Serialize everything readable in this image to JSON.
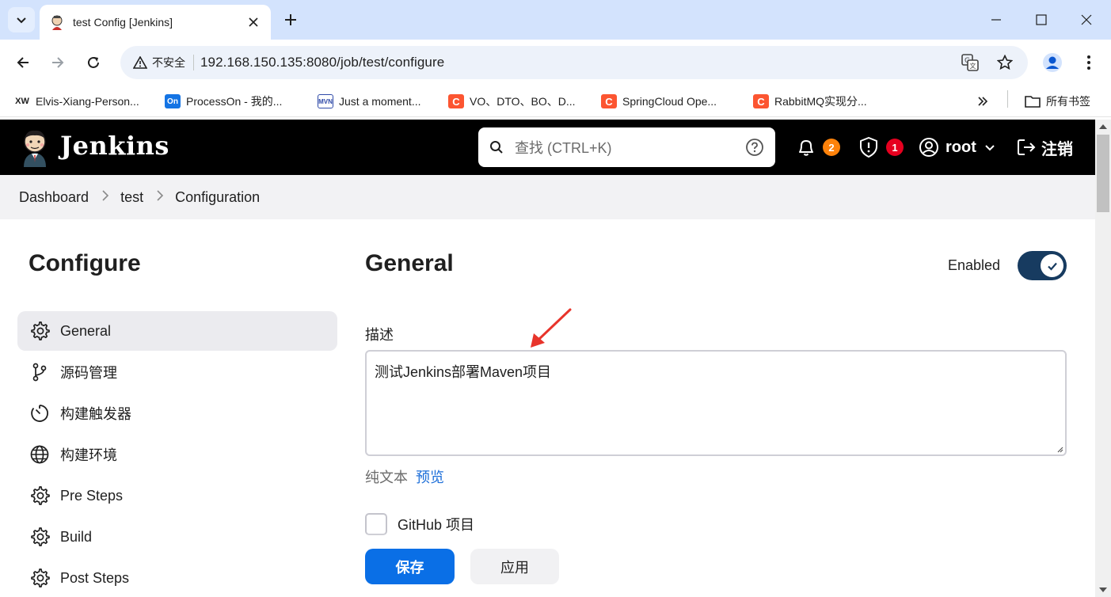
{
  "browser": {
    "tab_title": "test Config [Jenkins]",
    "security_label": "不安全",
    "url": "192.168.150.135:8080/job/test/configure",
    "bookmarks": [
      {
        "label": "Elvis-Xiang-Person...",
        "icon_text": "XW",
        "icon_color": "#1f1f1f"
      },
      {
        "label": "ProcessOn - 我的...",
        "icon_text": "On",
        "icon_color": "#1474e4"
      },
      {
        "label": "Just a moment...",
        "icon_text": "MVN",
        "icon_color": "#2f4aa8"
      },
      {
        "label": "VO、DTO、BO、D...",
        "icon_text": "C",
        "icon_color": "#fc5531"
      },
      {
        "label": "SpringCloud Ope...",
        "icon_text": "C",
        "icon_color": "#fc5531"
      },
      {
        "label": "RabbitMQ实现分...",
        "icon_text": "C",
        "icon_color": "#fc5531"
      }
    ],
    "all_bookmarks_label": "所有书签"
  },
  "jenkins": {
    "brand": "Jenkins",
    "search_placeholder": "查找 (CTRL+K)",
    "notifications_count": "2",
    "security_count": "1",
    "user": "root",
    "logout_label": "注销",
    "colors": {
      "header_bg": "#000000",
      "notif_badge": "#fe820a",
      "security_badge": "#e6001f",
      "primary": "#0a6fe6",
      "toggle": "#173b60"
    }
  },
  "breadcrumb": [
    "Dashboard",
    "test",
    "Configuration"
  ],
  "sidebar": {
    "title": "Configure",
    "items": [
      {
        "label": "General",
        "icon": "gear-icon",
        "active": true
      },
      {
        "label": "源码管理",
        "icon": "branch-icon",
        "active": false
      },
      {
        "label": "构建触发器",
        "icon": "timer-icon",
        "active": false
      },
      {
        "label": "构建环境",
        "icon": "globe-icon",
        "active": false
      },
      {
        "label": "Pre Steps",
        "icon": "gear-icon",
        "active": false
      },
      {
        "label": "Build",
        "icon": "gear-icon",
        "active": false
      },
      {
        "label": "Post Steps",
        "icon": "gear-icon",
        "active": false
      }
    ]
  },
  "main": {
    "title": "General",
    "enabled_label": "Enabled",
    "enabled": true,
    "description_label": "描述",
    "description_value": "测试Jenkins部署Maven项目",
    "format_plain": "纯文本",
    "format_preview": "预览",
    "github_label": "GitHub 项目",
    "github_checked": false,
    "save_label": "保存",
    "apply_label": "应用"
  }
}
